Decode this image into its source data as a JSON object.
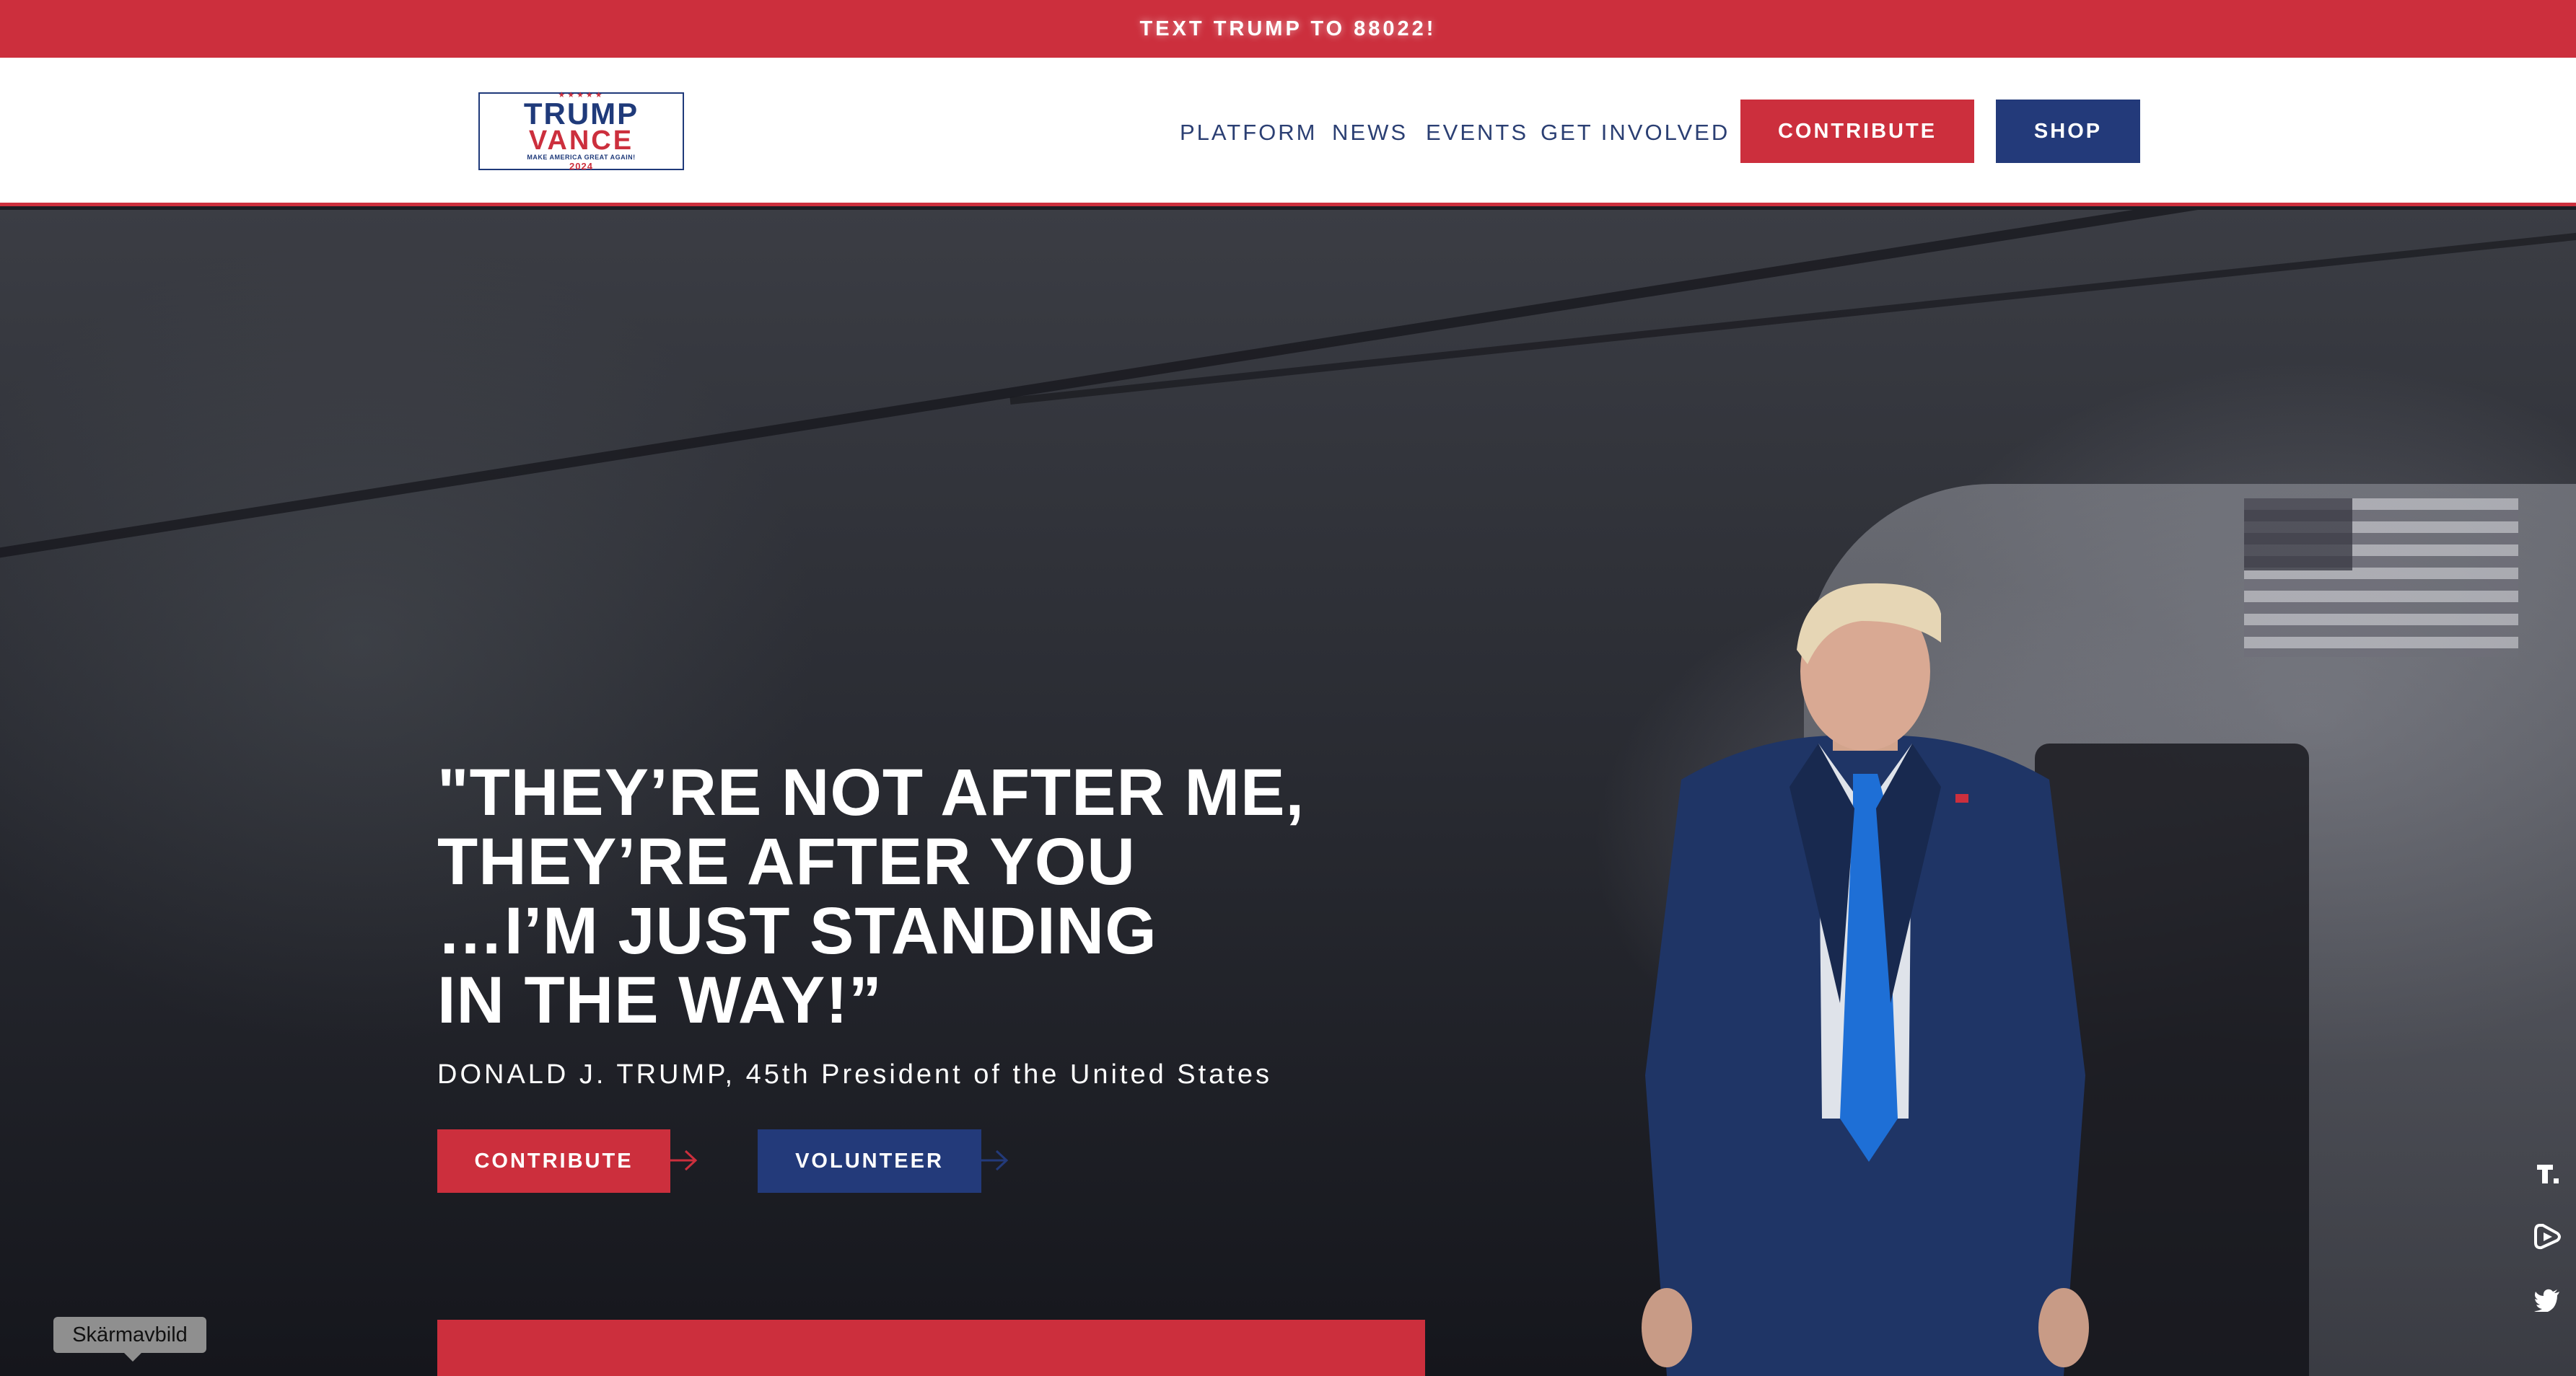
{
  "top_banner": {
    "text": "TEXT TRUMP TO 88022!"
  },
  "logo": {
    "stars": "★★★★★",
    "line1": "TRUMP",
    "line2": "VANCE",
    "line3": "MAKE AMERICA GREAT AGAIN!",
    "line4": "2024"
  },
  "nav": {
    "links": [
      "PLATFORM",
      "NEWS",
      "EVENTS",
      "GET INVOLVED"
    ],
    "contribute_label": "CONTRIBUTE",
    "shop_label": "SHOP"
  },
  "hero": {
    "quote_lines": [
      "\"THEY’RE NOT AFTER ME,",
      "THEY’RE AFTER YOU",
      "…I’M JUST STANDING",
      "IN THE WAY!”"
    ],
    "attribution": "DONALD J. TRUMP, 45th President of the United States",
    "contribute_label": "CONTRIBUTE",
    "volunteer_label": "VOLUNTEER"
  },
  "social_icons": [
    "truth-social-icon",
    "rumble-icon",
    "twitter-icon"
  ],
  "tooltip": {
    "text": "Skärmavbild"
  },
  "colors": {
    "red": "#cc2f3d",
    "navy": "#233a7a",
    "white": "#ffffff"
  }
}
